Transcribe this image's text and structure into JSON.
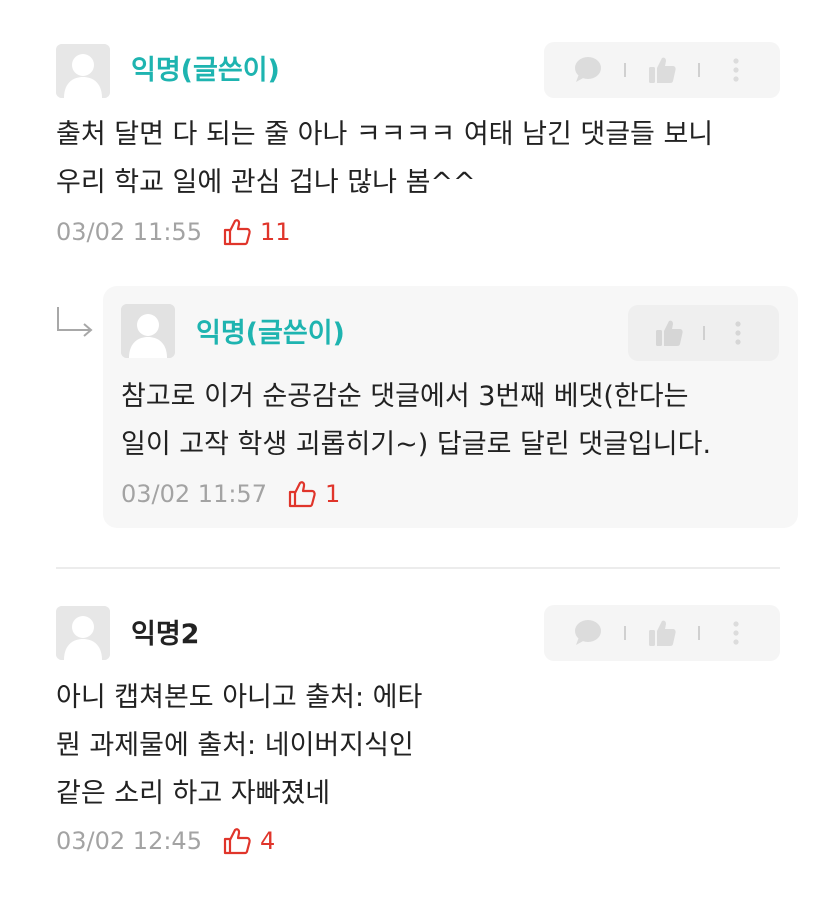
{
  "colors": {
    "writer_accent": "#1eb4b0",
    "like_red": "#e0352b",
    "meta_gray": "#a3a3a3",
    "action_bg": "#f5f5f5",
    "reply_bg": "#f7f7f7"
  },
  "comments": [
    {
      "author": "익명(글쓴이)",
      "is_writer": true,
      "text_lines": [
        "출처 달면 다 되는 줄 아나 ㅋㅋㅋㅋ 여태 남긴 댓글들 보니",
        "우리 학교 일에 관심 겁나 많나 봄^^"
      ],
      "time": "03/02 11:55",
      "likes": "11",
      "actions": [
        "comment-icon",
        "thumbs-up-icon",
        "more-icon"
      ]
    },
    {
      "author": "익명(글쓴이)",
      "is_writer": true,
      "is_reply": true,
      "text_lines": [
        "참고로 이거 순공감순 댓글에서 3번째 베댓(한다는",
        "일이 고작 학생 괴롭히기~) 답글로 달린 댓글입니다."
      ],
      "time": "03/02 11:57",
      "likes": "1",
      "actions": [
        "thumbs-up-icon",
        "more-icon"
      ]
    },
    {
      "author": "익명2",
      "is_writer": false,
      "text_lines": [
        "아니 캡쳐본도 아니고 출처: 에타",
        "뭔 과제물에 출처: 네이버지식인",
        "같은 소리 하고 자빠졌네"
      ],
      "time": "03/02 12:45",
      "likes": "4",
      "actions": [
        "comment-icon",
        "thumbs-up-icon",
        "more-icon"
      ]
    }
  ]
}
